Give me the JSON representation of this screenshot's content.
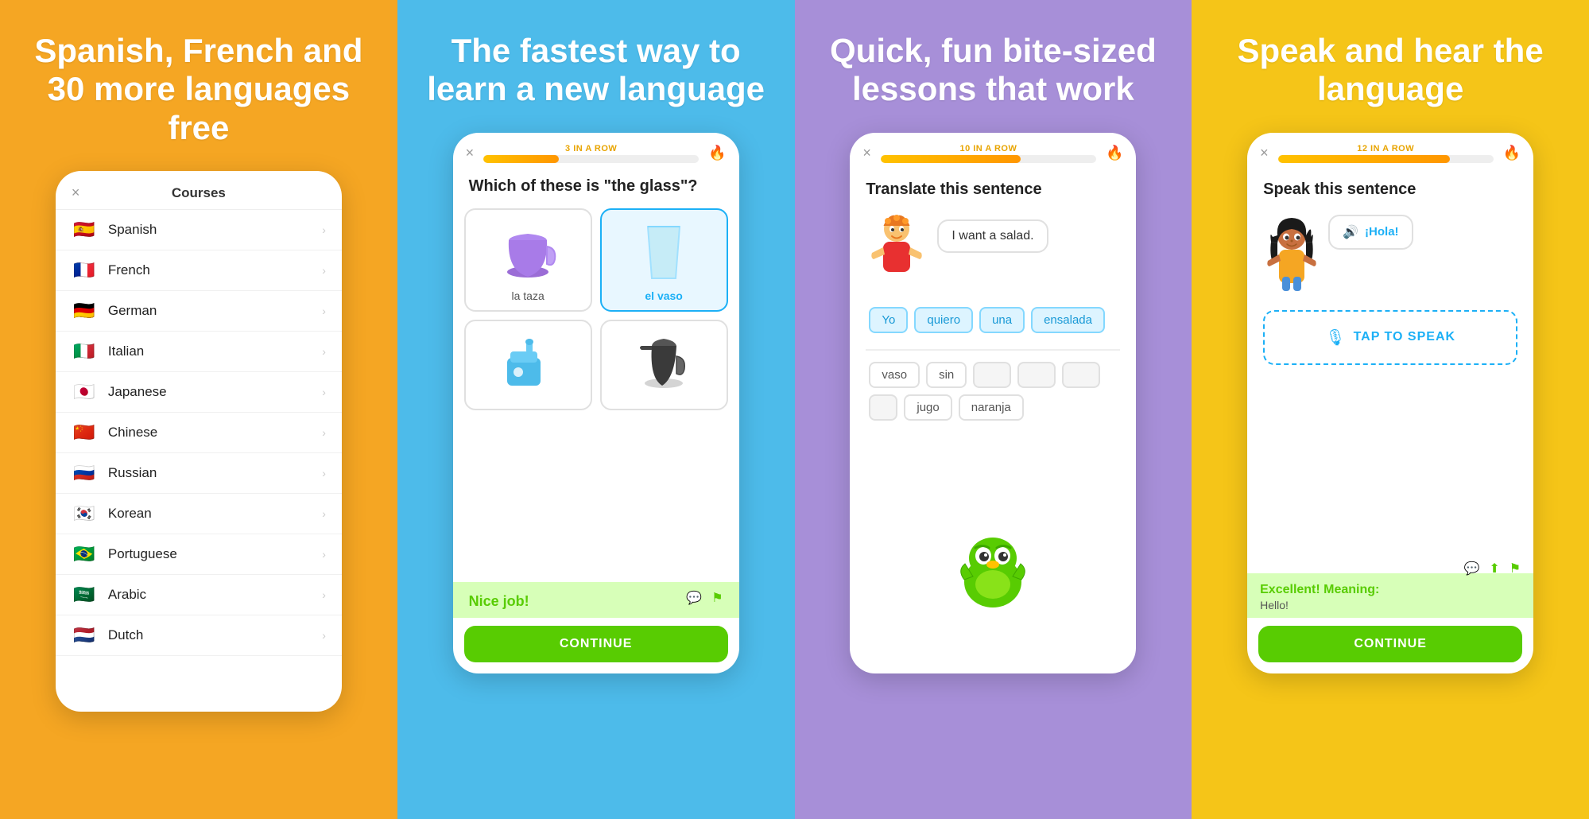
{
  "panel1": {
    "title": "Spanish, French and 30 more languages free",
    "bg": "#F5A623",
    "phone": {
      "header": "Courses",
      "close": "×",
      "courses": [
        {
          "flag": "🇪🇸",
          "name": "Spanish"
        },
        {
          "flag": "🇫🇷",
          "name": "French"
        },
        {
          "flag": "🇩🇪",
          "name": "German"
        },
        {
          "flag": "🇮🇹",
          "name": "Italian"
        },
        {
          "flag": "🇯🇵",
          "name": "Japanese"
        },
        {
          "flag": "🇨🇳",
          "name": "Chinese"
        },
        {
          "flag": "🇷🇺",
          "name": "Russian"
        },
        {
          "flag": "🇰🇷",
          "name": "Korean"
        },
        {
          "flag": "🇧🇷",
          "name": "Portuguese"
        },
        {
          "flag": "🇸🇦",
          "name": "Arabic"
        },
        {
          "flag": "🇳🇱",
          "name": "Dutch"
        }
      ]
    }
  },
  "panel2": {
    "title": "The fastest way to learn a new language",
    "bg": "#4DBBEA",
    "phone": {
      "close": "×",
      "streak": "3 IN A ROW",
      "progress": 35,
      "question": "Which of these is \"the glass\"?",
      "options": [
        {
          "label": "la taza",
          "selected": false
        },
        {
          "label": "el vaso",
          "selected": true
        },
        {
          "label": "",
          "selected": false
        },
        {
          "label": "",
          "selected": false
        }
      ],
      "feedback": "Nice job!",
      "continue_label": "CONTINUE"
    }
  },
  "panel3": {
    "title": "Quick, fun bite-sized lessons that work",
    "bg": "#A78FD8",
    "phone": {
      "close": "×",
      "streak": "10 IN A ROW",
      "progress": 65,
      "question": "Translate this sentence",
      "speech": "I want a salad.",
      "selected_chips": [
        "Yo",
        "quiero",
        "una",
        "ensalada"
      ],
      "word_bank": [
        "vaso",
        "sin",
        "",
        "",
        "",
        "",
        "jugo",
        "naranja"
      ],
      "continue_label": "CONTINUE"
    }
  },
  "panel4": {
    "title": "Speak and hear the language",
    "bg": "#F5C518",
    "phone": {
      "close": "×",
      "streak": "12 IN A ROW",
      "progress": 80,
      "question": "Speak this sentence",
      "speech_text": "¡Hola!",
      "tap_label": "TAP TO SPEAK",
      "excellent_title": "Excellent! Meaning:",
      "excellent_meaning": "Hello!",
      "continue_label": "CONTINUE"
    }
  },
  "icons": {
    "close": "×",
    "chevron": "›",
    "chat": "💬",
    "share": "⬆",
    "flag": "⚑",
    "mic": "🎙",
    "speaker": "🔊"
  }
}
